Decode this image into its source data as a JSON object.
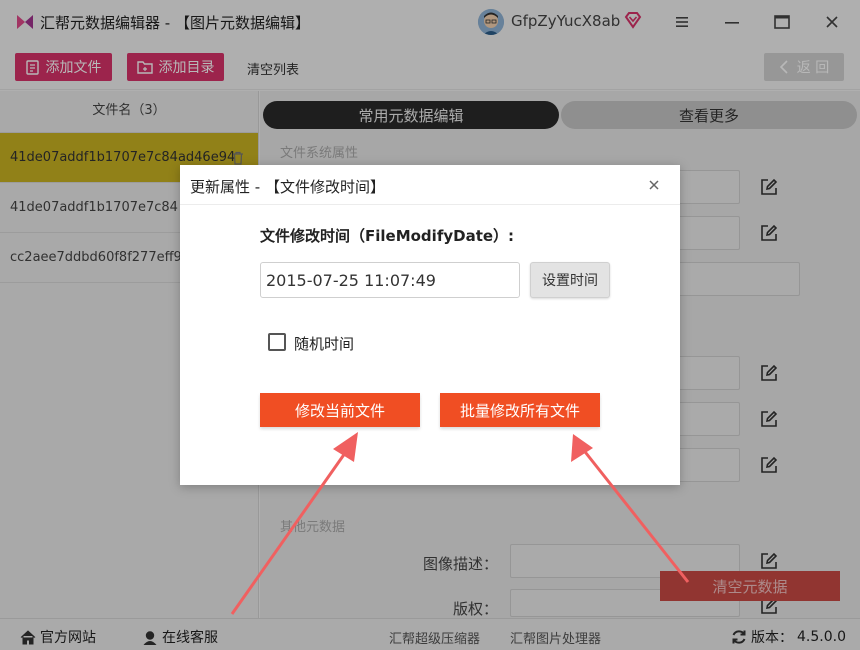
{
  "app": {
    "title": "汇帮元数据编辑器 - 【图片元数据编辑】",
    "username": "GfpZyYucX8ab"
  },
  "toolbar": {
    "add_file": "添加文件",
    "add_folder": "添加目录",
    "clear_list": "清空列表",
    "back": "返 回"
  },
  "file_list": {
    "header": "文件名（3）",
    "items": [
      "41de07addf1b1707e7c84ad46e94",
      "41de07addf1b1707e7c84",
      "cc2aee7ddbd60f8f277eff9"
    ]
  },
  "tabs": {
    "common": "常用元数据编辑",
    "more": "查看更多"
  },
  "sections": {
    "filesystem": "文件系统属性",
    "other": "其他元数据"
  },
  "fields": {
    "image_desc": "图像描述：",
    "copyright": "版权："
  },
  "clear_metadata": "清空元数据",
  "modal": {
    "title": "更新属性 - 【文件修改时间】",
    "field_label": "文件修改时间（FileModifyDate）:",
    "time_value": "2015-07-25 11:07:49",
    "set_time": "设置时间",
    "random_time": "随机时间",
    "modify_current": "修改当前文件",
    "modify_all": "批量修改所有文件"
  },
  "statusbar": {
    "website": "官方网站",
    "service": "在线客服",
    "compressor": "汇帮超级压缩器",
    "image_tool": "汇帮图片处理器",
    "version": "版本：",
    "version_number": "4.5.0.0"
  },
  "colors": {
    "pink": "#d9326a",
    "orange": "#f04e23",
    "selected_row": "#c9b322",
    "arrow": "#f06060"
  }
}
